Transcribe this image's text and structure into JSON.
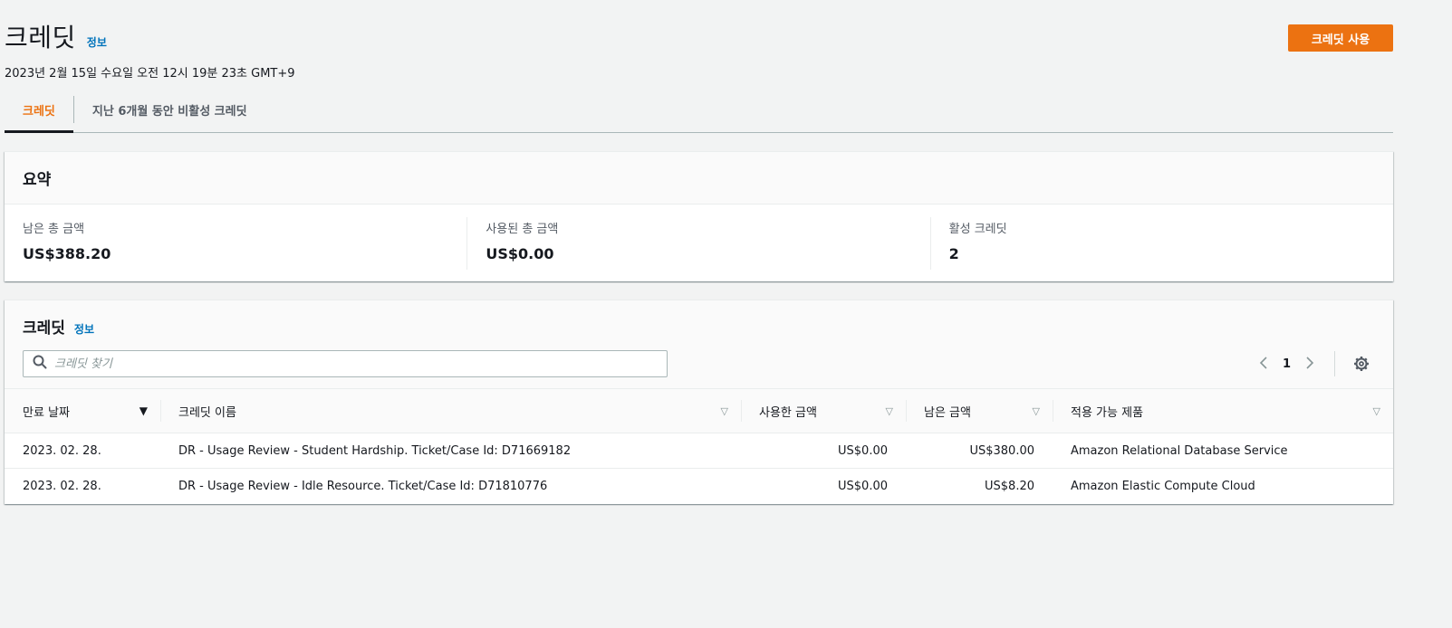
{
  "header": {
    "title": "크레딧",
    "info_label": "정보",
    "datetime": "2023년 2월 15일 수요일 오전 12시 19분 23초 GMT+9",
    "primary_button": "크레딧 사용"
  },
  "tabs": [
    {
      "label": "크레딧",
      "active": true
    },
    {
      "label": "지난 6개월 동안 비활성 크레딧",
      "active": false
    }
  ],
  "summary": {
    "title": "요약",
    "items": [
      {
        "label": "남은 총 금액",
        "value": "US$388.20"
      },
      {
        "label": "사용된 총 금액",
        "value": "US$0.00"
      },
      {
        "label": "활성 크레딧",
        "value": "2"
      }
    ]
  },
  "credits": {
    "title": "크레딧",
    "info_label": "정보",
    "search_placeholder": "크레딧 찾기",
    "page": "1",
    "columns": [
      "만료 날짜",
      "크레딧 이름",
      "사용한 금액",
      "남은 금액",
      "적용 가능 제품"
    ],
    "rows": [
      {
        "expiry": "2023. 02. 28.",
        "name": "DR - Usage Review - Student Hardship. Ticket/Case Id: D71669182",
        "used": "US$0.00",
        "remaining": "US$380.00",
        "product": "Amazon Relational Database Service"
      },
      {
        "expiry": "2023. 02. 28.",
        "name": "DR - Usage Review - Idle Resource. Ticket/Case Id: D71810776",
        "used": "US$0.00",
        "remaining": "US$8.20",
        "product": "Amazon Elastic Compute Cloud"
      }
    ]
  },
  "colors": {
    "accent": "#ec7211",
    "link": "#0073bb",
    "text": "#16191f",
    "background": "#f2f3f3"
  },
  "icons": {
    "search": "search-icon",
    "prev": "chevron-left-icon",
    "next": "chevron-right-icon",
    "settings": "gear-icon",
    "sort": "caret-down-icon"
  }
}
